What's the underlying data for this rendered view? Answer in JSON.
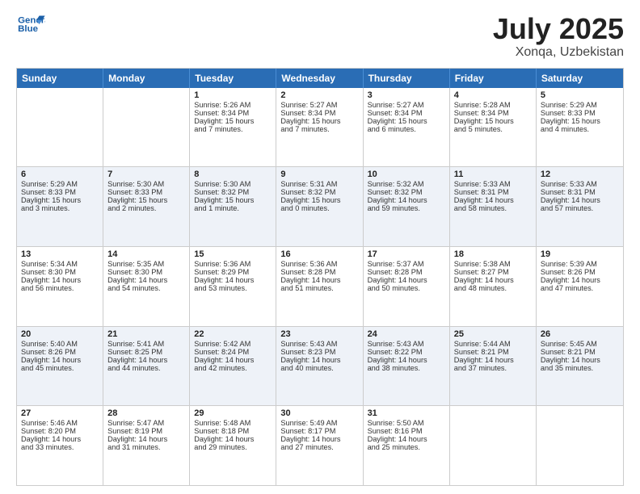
{
  "logo": {
    "line1": "General",
    "line2": "Blue"
  },
  "title": "July 2025",
  "location": "Xonqa, Uzbekistan",
  "weekdays": [
    "Sunday",
    "Monday",
    "Tuesday",
    "Wednesday",
    "Thursday",
    "Friday",
    "Saturday"
  ],
  "rows": [
    [
      {
        "day": "",
        "lines": []
      },
      {
        "day": "",
        "lines": []
      },
      {
        "day": "1",
        "lines": [
          "Sunrise: 5:26 AM",
          "Sunset: 8:34 PM",
          "Daylight: 15 hours",
          "and 7 minutes."
        ]
      },
      {
        "day": "2",
        "lines": [
          "Sunrise: 5:27 AM",
          "Sunset: 8:34 PM",
          "Daylight: 15 hours",
          "and 7 minutes."
        ]
      },
      {
        "day": "3",
        "lines": [
          "Sunrise: 5:27 AM",
          "Sunset: 8:34 PM",
          "Daylight: 15 hours",
          "and 6 minutes."
        ]
      },
      {
        "day": "4",
        "lines": [
          "Sunrise: 5:28 AM",
          "Sunset: 8:34 PM",
          "Daylight: 15 hours",
          "and 5 minutes."
        ]
      },
      {
        "day": "5",
        "lines": [
          "Sunrise: 5:29 AM",
          "Sunset: 8:33 PM",
          "Daylight: 15 hours",
          "and 4 minutes."
        ]
      }
    ],
    [
      {
        "day": "6",
        "lines": [
          "Sunrise: 5:29 AM",
          "Sunset: 8:33 PM",
          "Daylight: 15 hours",
          "and 3 minutes."
        ]
      },
      {
        "day": "7",
        "lines": [
          "Sunrise: 5:30 AM",
          "Sunset: 8:33 PM",
          "Daylight: 15 hours",
          "and 2 minutes."
        ]
      },
      {
        "day": "8",
        "lines": [
          "Sunrise: 5:30 AM",
          "Sunset: 8:32 PM",
          "Daylight: 15 hours",
          "and 1 minute."
        ]
      },
      {
        "day": "9",
        "lines": [
          "Sunrise: 5:31 AM",
          "Sunset: 8:32 PM",
          "Daylight: 15 hours",
          "and 0 minutes."
        ]
      },
      {
        "day": "10",
        "lines": [
          "Sunrise: 5:32 AM",
          "Sunset: 8:32 PM",
          "Daylight: 14 hours",
          "and 59 minutes."
        ]
      },
      {
        "day": "11",
        "lines": [
          "Sunrise: 5:33 AM",
          "Sunset: 8:31 PM",
          "Daylight: 14 hours",
          "and 58 minutes."
        ]
      },
      {
        "day": "12",
        "lines": [
          "Sunrise: 5:33 AM",
          "Sunset: 8:31 PM",
          "Daylight: 14 hours",
          "and 57 minutes."
        ]
      }
    ],
    [
      {
        "day": "13",
        "lines": [
          "Sunrise: 5:34 AM",
          "Sunset: 8:30 PM",
          "Daylight: 14 hours",
          "and 56 minutes."
        ]
      },
      {
        "day": "14",
        "lines": [
          "Sunrise: 5:35 AM",
          "Sunset: 8:30 PM",
          "Daylight: 14 hours",
          "and 54 minutes."
        ]
      },
      {
        "day": "15",
        "lines": [
          "Sunrise: 5:36 AM",
          "Sunset: 8:29 PM",
          "Daylight: 14 hours",
          "and 53 minutes."
        ]
      },
      {
        "day": "16",
        "lines": [
          "Sunrise: 5:36 AM",
          "Sunset: 8:28 PM",
          "Daylight: 14 hours",
          "and 51 minutes."
        ]
      },
      {
        "day": "17",
        "lines": [
          "Sunrise: 5:37 AM",
          "Sunset: 8:28 PM",
          "Daylight: 14 hours",
          "and 50 minutes."
        ]
      },
      {
        "day": "18",
        "lines": [
          "Sunrise: 5:38 AM",
          "Sunset: 8:27 PM",
          "Daylight: 14 hours",
          "and 48 minutes."
        ]
      },
      {
        "day": "19",
        "lines": [
          "Sunrise: 5:39 AM",
          "Sunset: 8:26 PM",
          "Daylight: 14 hours",
          "and 47 minutes."
        ]
      }
    ],
    [
      {
        "day": "20",
        "lines": [
          "Sunrise: 5:40 AM",
          "Sunset: 8:26 PM",
          "Daylight: 14 hours",
          "and 45 minutes."
        ]
      },
      {
        "day": "21",
        "lines": [
          "Sunrise: 5:41 AM",
          "Sunset: 8:25 PM",
          "Daylight: 14 hours",
          "and 44 minutes."
        ]
      },
      {
        "day": "22",
        "lines": [
          "Sunrise: 5:42 AM",
          "Sunset: 8:24 PM",
          "Daylight: 14 hours",
          "and 42 minutes."
        ]
      },
      {
        "day": "23",
        "lines": [
          "Sunrise: 5:43 AM",
          "Sunset: 8:23 PM",
          "Daylight: 14 hours",
          "and 40 minutes."
        ]
      },
      {
        "day": "24",
        "lines": [
          "Sunrise: 5:43 AM",
          "Sunset: 8:22 PM",
          "Daylight: 14 hours",
          "and 38 minutes."
        ]
      },
      {
        "day": "25",
        "lines": [
          "Sunrise: 5:44 AM",
          "Sunset: 8:21 PM",
          "Daylight: 14 hours",
          "and 37 minutes."
        ]
      },
      {
        "day": "26",
        "lines": [
          "Sunrise: 5:45 AM",
          "Sunset: 8:21 PM",
          "Daylight: 14 hours",
          "and 35 minutes."
        ]
      }
    ],
    [
      {
        "day": "27",
        "lines": [
          "Sunrise: 5:46 AM",
          "Sunset: 8:20 PM",
          "Daylight: 14 hours",
          "and 33 minutes."
        ]
      },
      {
        "day": "28",
        "lines": [
          "Sunrise: 5:47 AM",
          "Sunset: 8:19 PM",
          "Daylight: 14 hours",
          "and 31 minutes."
        ]
      },
      {
        "day": "29",
        "lines": [
          "Sunrise: 5:48 AM",
          "Sunset: 8:18 PM",
          "Daylight: 14 hours",
          "and 29 minutes."
        ]
      },
      {
        "day": "30",
        "lines": [
          "Sunrise: 5:49 AM",
          "Sunset: 8:17 PM",
          "Daylight: 14 hours",
          "and 27 minutes."
        ]
      },
      {
        "day": "31",
        "lines": [
          "Sunrise: 5:50 AM",
          "Sunset: 8:16 PM",
          "Daylight: 14 hours",
          "and 25 minutes."
        ]
      },
      {
        "day": "",
        "lines": []
      },
      {
        "day": "",
        "lines": []
      }
    ]
  ]
}
